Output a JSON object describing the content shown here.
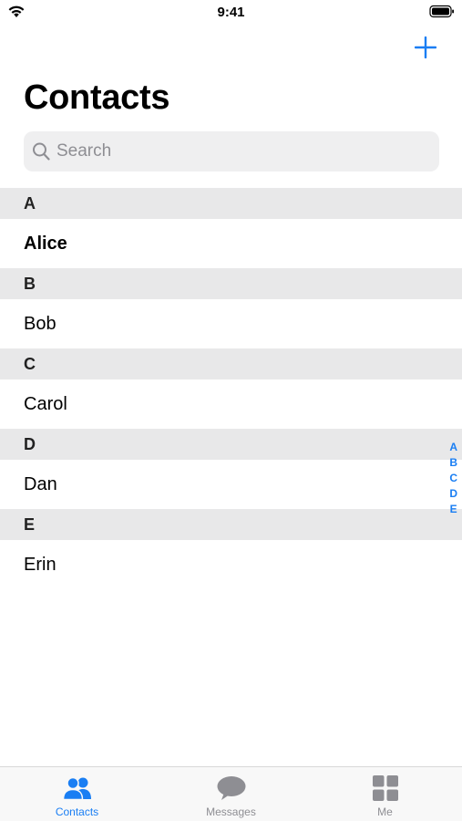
{
  "status_bar": {
    "time": "9:41"
  },
  "header": {
    "title": "Contacts",
    "add_icon": "plus-icon"
  },
  "search": {
    "placeholder": "Search",
    "value": ""
  },
  "sections": [
    {
      "letter": "A",
      "contacts": [
        {
          "name": "Alice",
          "bold": true
        }
      ]
    },
    {
      "letter": "B",
      "contacts": [
        {
          "name": "Bob",
          "bold": false
        }
      ]
    },
    {
      "letter": "C",
      "contacts": [
        {
          "name": "Carol",
          "bold": false
        }
      ]
    },
    {
      "letter": "D",
      "contacts": [
        {
          "name": "Dan",
          "bold": false
        }
      ]
    },
    {
      "letter": "E",
      "contacts": [
        {
          "name": "Erin",
          "bold": false
        }
      ]
    }
  ],
  "section_index": [
    "A",
    "B",
    "C",
    "D",
    "E"
  ],
  "tab_bar": {
    "tabs": [
      {
        "label": "Contacts",
        "icon": "people-icon",
        "active": true
      },
      {
        "label": "Messages",
        "icon": "chat-bubble-icon",
        "active": false
      },
      {
        "label": "Me",
        "icon": "grid-icon",
        "active": false
      }
    ]
  },
  "colors": {
    "accent": "#1a7ef3",
    "section_header_bg": "#e8e8e9",
    "search_bg": "#efeff0",
    "inactive_tab": "#8e8e93"
  }
}
